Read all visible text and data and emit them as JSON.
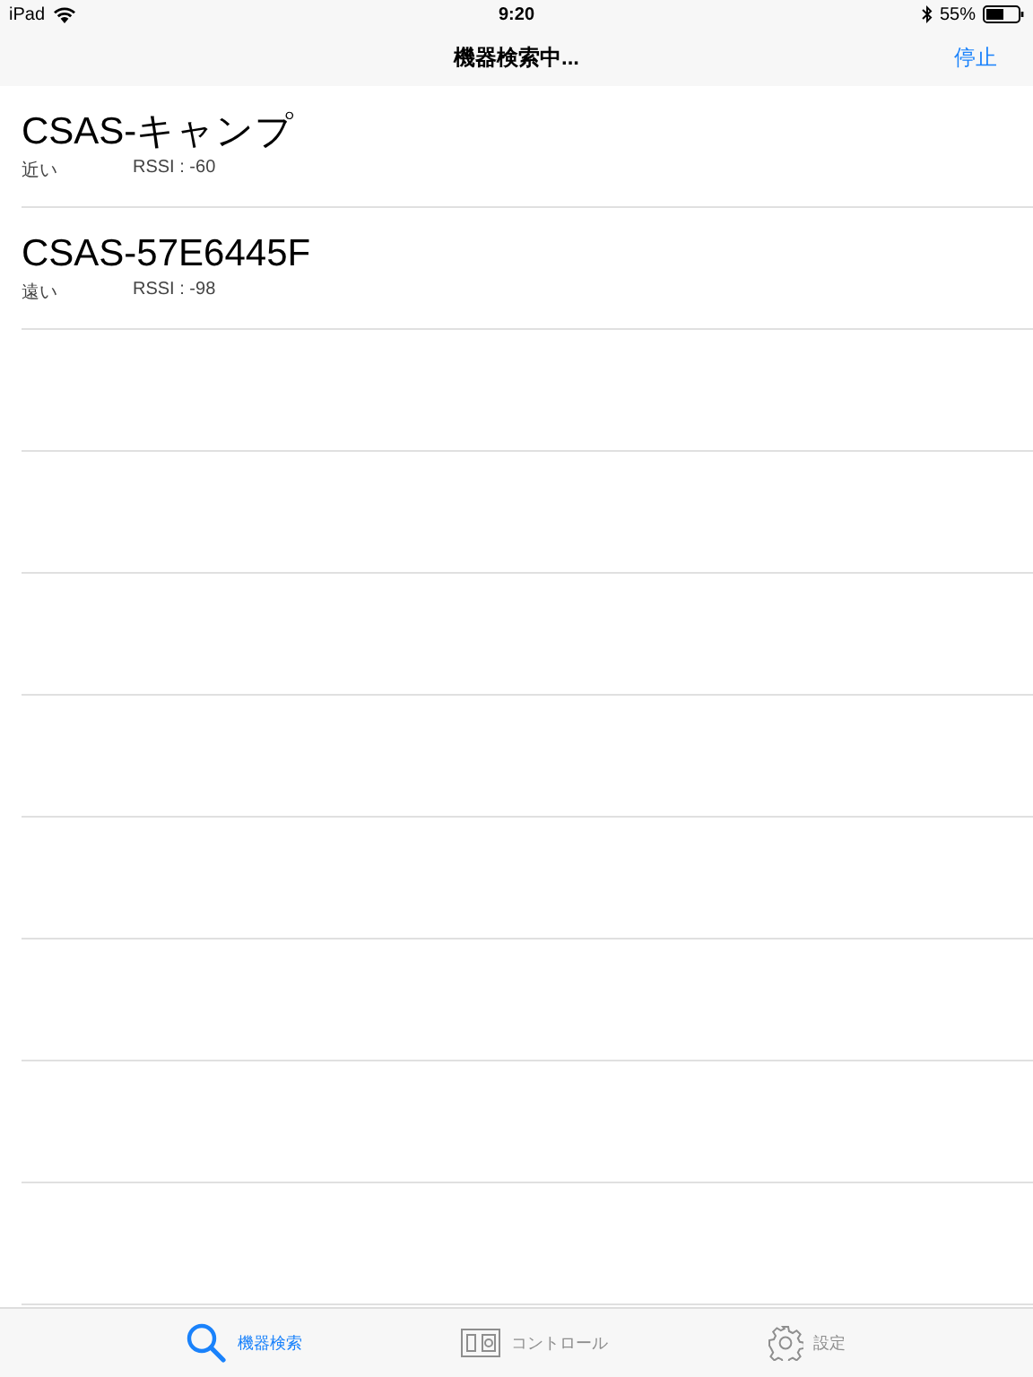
{
  "status_bar": {
    "device": "iPad",
    "time": "9:20",
    "battery": "55%"
  },
  "nav": {
    "title": "機器検索中...",
    "action": "停止"
  },
  "devices": [
    {
      "name": "CSAS-キャンプ",
      "distance": "近い",
      "rssi": "RSSI : -60"
    },
    {
      "name": "CSAS-57E6445F",
      "distance": "遠い",
      "rssi": "RSSI : -98"
    }
  ],
  "tabs": [
    {
      "kind": "search",
      "label": "機器検索",
      "selected": true
    },
    {
      "kind": "control",
      "label": "コントロール",
      "selected": false
    },
    {
      "kind": "settings",
      "label": "設定",
      "selected": false
    }
  ]
}
